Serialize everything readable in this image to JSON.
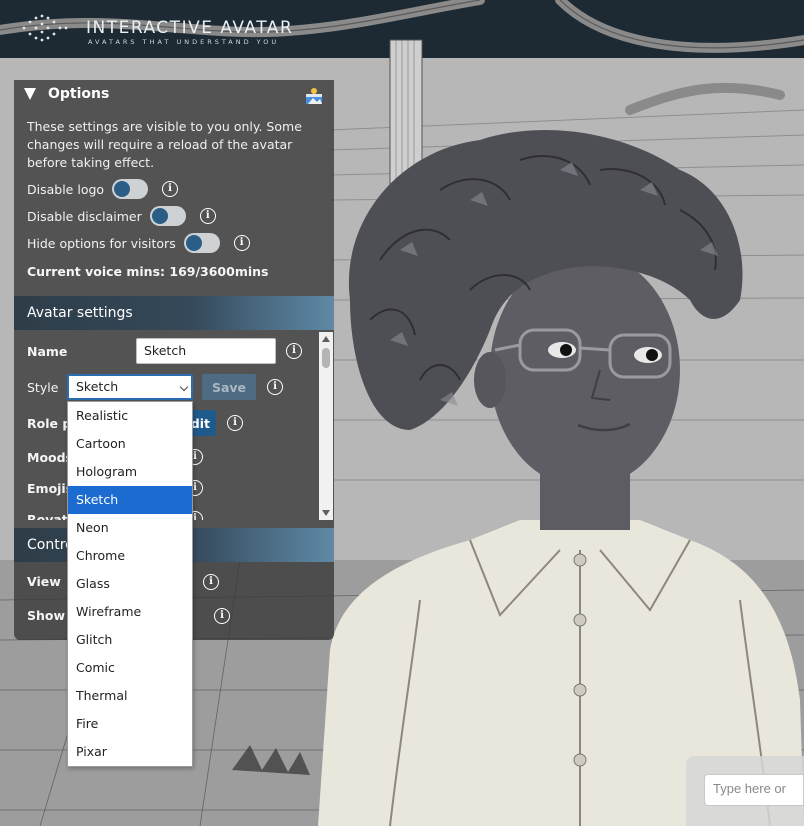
{
  "brand": {
    "title": "INTERACTIVE AVATAR",
    "tagline": "AVATARS THAT UNDERSTAND YOU"
  },
  "options": {
    "title": "Options",
    "description": "These settings are visible to you only. Some changes will require a reload of the avatar before taking effect.",
    "toggles": [
      {
        "label": "Disable logo",
        "on": true
      },
      {
        "label": "Disable disclaimer",
        "on": true
      },
      {
        "label": "Hide options for visitors",
        "on": true
      }
    ],
    "voice_label": "Current voice mins:",
    "voice_value": "169/3600mins"
  },
  "avatar_settings": {
    "title": "Avatar settings",
    "name_label": "Name",
    "name_value": "Sketch",
    "style_label": "Style",
    "style_value": "Sketch",
    "save_label": "Save",
    "role_label": "Role p",
    "edit_label": "dit",
    "moods_label": "Moods",
    "emojis_label": "Emojis",
    "partial_label": "Rovati"
  },
  "controls": {
    "title": "Contro",
    "view_label": "View",
    "show_label": "Show c"
  },
  "style_options": [
    "Realistic",
    "Cartoon",
    "Hologram",
    "Sketch",
    "Neon",
    "Chrome",
    "Glass",
    "Wireframe",
    "Glitch",
    "Comic",
    "Thermal",
    "Fire",
    "Pixar"
  ],
  "selected_style_index": 3,
  "chat": {
    "placeholder": "Type here or"
  },
  "colors": {
    "accent": "#1b6bd1",
    "toggle_knob": "#2a5e86",
    "section_bar": "#34495a"
  }
}
